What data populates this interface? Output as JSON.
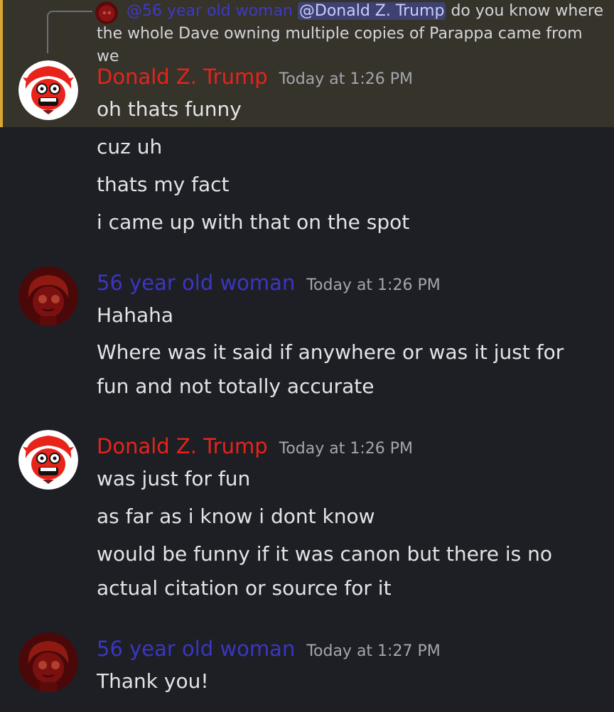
{
  "reply": {
    "author": "@56 year old woman",
    "mention": "@Donald Z. Trump",
    "text_part1": " do you know where",
    "text_part2": "the whole Dave owning multiple copies of Parappa came from we"
  },
  "messages": [
    {
      "author": "Donald Z. Trump",
      "timestamp": "Today at 1:26 PM",
      "lines": [
        "oh thats funny",
        "cuz uh",
        "thats my fact",
        "i came up with that on the spot"
      ]
    },
    {
      "author": "56 year old woman",
      "timestamp": "Today at 1:26 PM",
      "lines": [
        "Hahaha",
        "Where was it said if anywhere or was it just for",
        "fun and not totally accurate"
      ]
    },
    {
      "author": "Donald Z. Trump",
      "timestamp": "Today at 1:26 PM",
      "lines": [
        "was just for fun",
        "as far as i know i dont know",
        "would be funny if it was canon but there is no",
        "actual citation or source for it"
      ]
    },
    {
      "author": "56 year old woman",
      "timestamp": "Today at 1:27 PM",
      "lines": [
        "Thank you!"
      ]
    }
  ],
  "colors": {
    "background": "#1e1f24",
    "highlight_background": "#36332b",
    "highlight_bar": "#d9a531",
    "trump_name": "#e8231a",
    "woman_name": "#3b36c2",
    "timestamp": "#a4a6ad"
  }
}
